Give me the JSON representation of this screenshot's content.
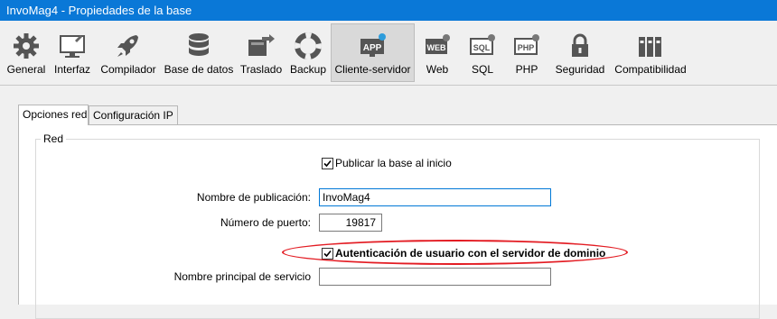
{
  "window": {
    "title": "InvoMag4 - Propiedades de la base"
  },
  "toolbar": {
    "items": [
      {
        "label": "General",
        "icon": "gear-icon"
      },
      {
        "label": "Interfaz",
        "icon": "monitor-icon"
      },
      {
        "label": "Compilador",
        "icon": "rocket-icon"
      },
      {
        "label": "Base de datos",
        "icon": "database-icon"
      },
      {
        "label": "Traslado",
        "icon": "transfer-icon"
      },
      {
        "label": "Backup",
        "icon": "lifebuoy-icon"
      },
      {
        "label": "Cliente-servidor",
        "icon": "app-server-icon",
        "active": true
      },
      {
        "label": "Web",
        "icon": "web-icon"
      },
      {
        "label": "SQL",
        "icon": "sql-icon"
      },
      {
        "label": "PHP",
        "icon": "php-icon"
      },
      {
        "label": "Seguridad",
        "icon": "lock-icon"
      },
      {
        "label": "Compatibilidad",
        "icon": "binders-icon"
      }
    ],
    "icon_texts": {
      "app": "APP",
      "web": "WEB",
      "sql": "SQL",
      "php": "PHP"
    }
  },
  "tabs": [
    {
      "label": "Opciones red",
      "selected": true
    },
    {
      "label": "Configuración IP",
      "selected": false
    }
  ],
  "group": {
    "title": "Red",
    "publish_checkbox": {
      "label": "Publicar la base al inicio",
      "checked": true
    },
    "publication_name": {
      "label": "Nombre de publicación:",
      "value": "InvoMag4"
    },
    "port_number": {
      "label": "Número de puerto:",
      "value": "19817"
    },
    "domain_auth_checkbox": {
      "label": "Autenticación de usuario con el servidor de dominio",
      "checked": true
    },
    "service_principal_name": {
      "label": "Nombre principal de servicio",
      "value": ""
    }
  },
  "colors": {
    "titlebar": "#0a78d7",
    "highlight": "#e31c23",
    "focus": "#0078d7"
  }
}
